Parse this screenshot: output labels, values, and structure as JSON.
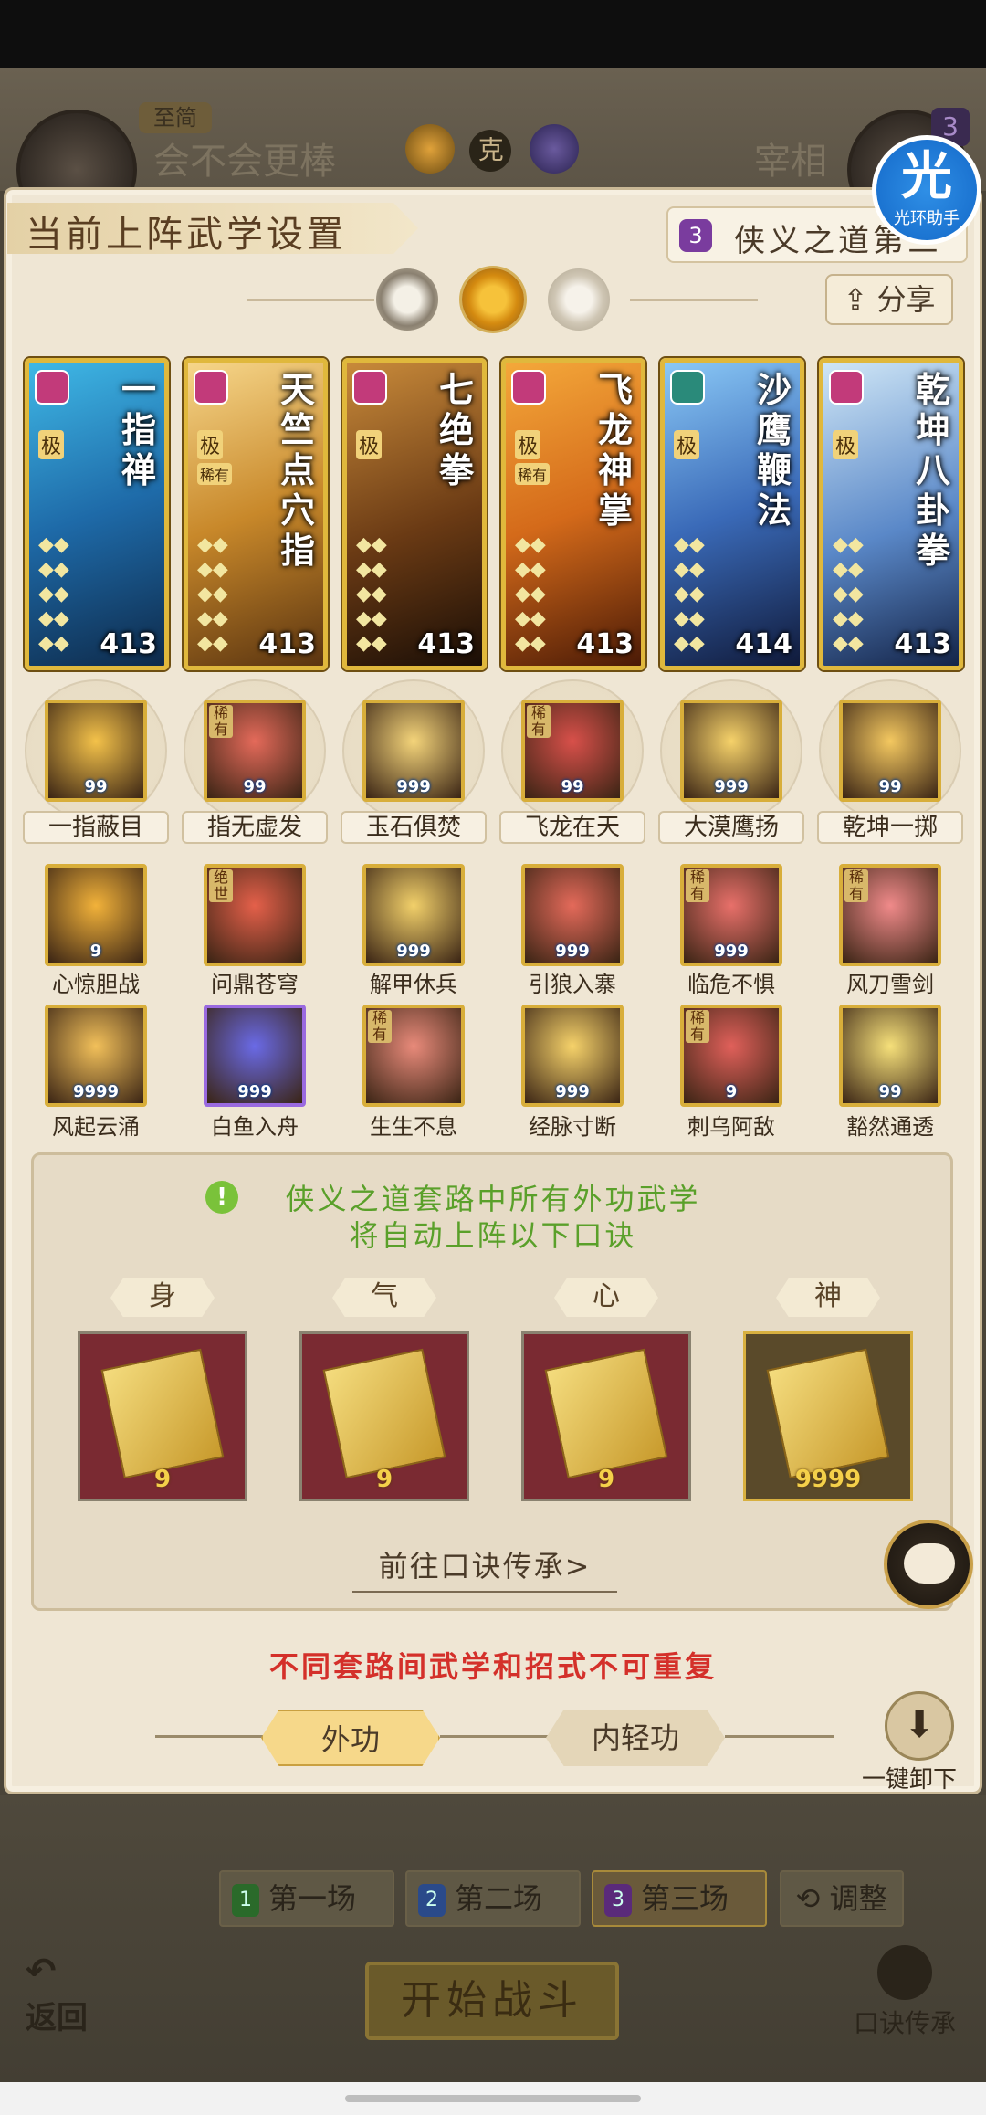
{
  "opponent_bar": {
    "player_tag": "至简",
    "player_name": "会不会更棒",
    "vs_mark": "克",
    "enemy_name": "宰相",
    "enemy_level": "3"
  },
  "helper_badge": {
    "icon": "光",
    "label": "光环助手"
  },
  "header": {
    "title": "当前上阵武学设置",
    "set_number": "3",
    "set_name": "侠义之道第三",
    "share_label": "分享"
  },
  "cards": [
    {
      "title": "一指禅",
      "rank": "极",
      "power": "413",
      "sect_color": "#c23a7a"
    },
    {
      "title": "天竺点穴指",
      "rank": "极",
      "badge": "稀有",
      "power": "413",
      "sect_color": "#c23a7a"
    },
    {
      "title": "七绝拳",
      "rank": "极",
      "power": "413",
      "sect_color": "#c23a7a"
    },
    {
      "title": "飞龙神掌",
      "rank": "极",
      "badge": "稀有",
      "power": "413",
      "sect_color": "#c23a7a"
    },
    {
      "title": "沙鹰鞭法",
      "rank": "极",
      "power": "414",
      "sect_color": "#2a8a7a"
    },
    {
      "title": "乾坤八卦拳",
      "rank": "极",
      "power": "413",
      "sect_color": "#c23a7a"
    }
  ],
  "skills_row1": [
    {
      "name": "一指蔽目",
      "level": "99"
    },
    {
      "name": "指无虚发",
      "level": "99",
      "badge": "稀有"
    },
    {
      "name": "玉石俱焚",
      "level": "999"
    },
    {
      "name": "飞龙在天",
      "level": "99",
      "badge": "稀有"
    },
    {
      "name": "大漠鹰扬",
      "level": "999"
    },
    {
      "name": "乾坤一掷",
      "level": "99"
    }
  ],
  "skills_row2": [
    {
      "name": "心惊胆战",
      "level": "9"
    },
    {
      "name": "问鼎苍穹",
      "level": "",
      "badge": "绝世"
    },
    {
      "name": "解甲休兵",
      "level": "999"
    },
    {
      "name": "引狼入寨",
      "level": "999"
    },
    {
      "name": "临危不惧",
      "level": "999",
      "badge": "稀有"
    },
    {
      "name": "风刀雪剑",
      "level": "",
      "badge": "稀有"
    }
  ],
  "skills_row3": [
    {
      "name": "风起云涌",
      "level": "9999"
    },
    {
      "name": "白鱼入舟",
      "level": "999"
    },
    {
      "name": "生生不息",
      "level": "",
      "badge": "稀有"
    },
    {
      "name": "经脉寸断",
      "level": "999"
    },
    {
      "name": "刺乌阿敌",
      "level": "9",
      "badge": "稀有"
    },
    {
      "name": "豁然通透",
      "level": "99"
    }
  ],
  "info": {
    "line1": "侠义之道套路中所有外功武学",
    "line2": "将自动上阵以下口诀",
    "tabs": [
      "身",
      "气",
      "心",
      "神"
    ],
    "mantra_levels": [
      "9",
      "9",
      "9",
      "9999"
    ],
    "goto_label": "前往口诀传承>"
  },
  "warning": "不同套路间武学和招式不可重复",
  "modes": {
    "outer": "外功",
    "inner": "内轻功"
  },
  "unload_label": "一键卸下",
  "rounds": [
    {
      "num": "1",
      "label": "第一场"
    },
    {
      "num": "2",
      "label": "第二场"
    },
    {
      "num": "3",
      "label": "第三场"
    }
  ],
  "adjust_label": "调整",
  "start_label": "开始战斗",
  "back_label": "返回",
  "mantra_inherit_label": "口诀传承"
}
